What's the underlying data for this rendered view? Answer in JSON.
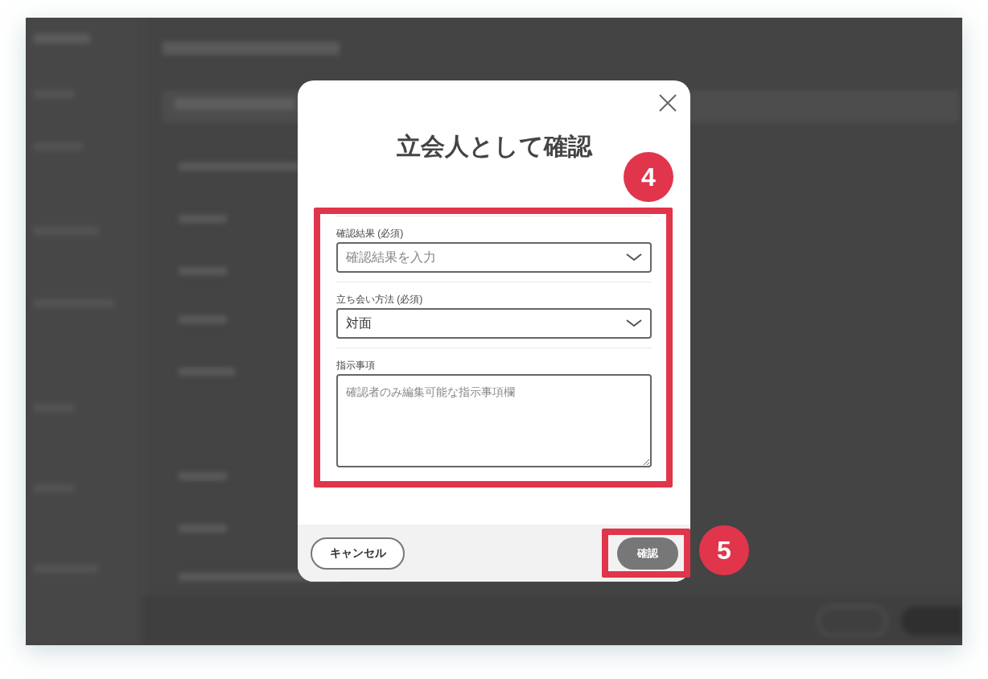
{
  "dialog": {
    "title": "立会人として確認",
    "fields": [
      {
        "kind": "select",
        "label": "確認結果 (必須)",
        "placeholder": "確認結果を入力"
      },
      {
        "kind": "select",
        "label": "立ち会い方法 (必須)",
        "value": "対面"
      },
      {
        "kind": "textarea",
        "label": "指示事項",
        "placeholder": "確認者のみ編集可能な指示事項欄"
      }
    ],
    "buttons": [
      {
        "kind": "secondary",
        "label": "キャンセル"
      },
      {
        "kind": "primary",
        "label": "確認"
      }
    ]
  },
  "annotations": [
    {
      "label": "4"
    },
    {
      "label": "5"
    }
  ]
}
